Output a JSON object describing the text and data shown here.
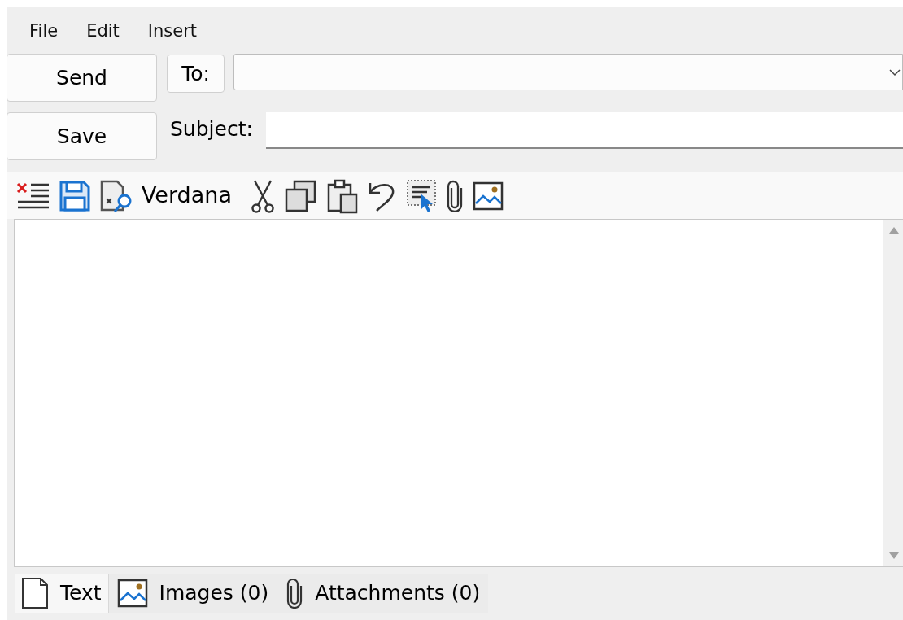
{
  "menu": [
    "File",
    "Edit",
    "Insert"
  ],
  "send_button": "Send",
  "to_button": "To:",
  "save_button": "Save",
  "subject_label": "Subject:",
  "toolbar": {
    "font": "Verdana"
  },
  "tabs": [
    {
      "label": "Text",
      "kind": "text",
      "selected": true
    },
    {
      "label": "Images (0)",
      "kind": "images",
      "selected": false
    },
    {
      "label": "Attachments (0)",
      "kind": "attachments",
      "selected": false
    }
  ]
}
